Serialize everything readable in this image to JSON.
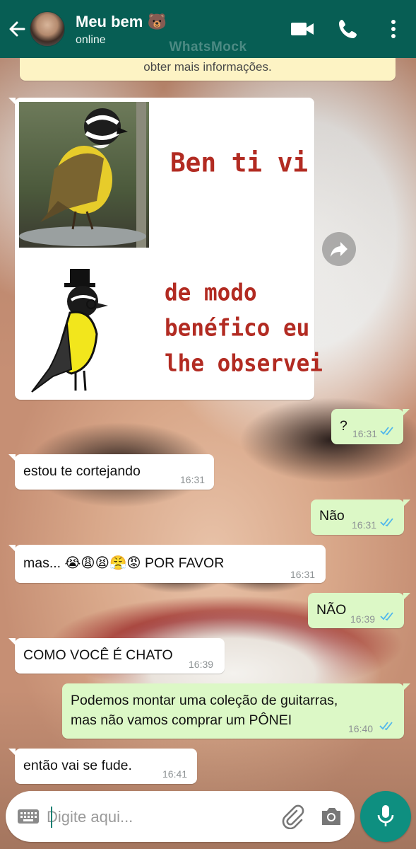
{
  "header": {
    "contact_name": "Meu bem 🐻",
    "status": "online",
    "watermark": "WhatsMock",
    "icons": [
      "back-arrow-icon",
      "video-call-icon",
      "phone-icon",
      "more-vert-icon"
    ]
  },
  "info_banner": "obter mais informações.",
  "messages": [
    {
      "dir": "in",
      "type": "image",
      "meme": {
        "line1": "Ben ti vi",
        "line2": "de modo",
        "line3": "benéfico eu",
        "line4": "lhe observei"
      }
    },
    {
      "dir": "out",
      "text": "?",
      "time": "16:31",
      "read": true
    },
    {
      "dir": "in",
      "text": "estou te cortejando",
      "time": "16:31"
    },
    {
      "dir": "out",
      "text": "Não",
      "time": "16:31",
      "read": true
    },
    {
      "dir": "in",
      "text": "mas... 😭😩😫😤😡 POR FAVOR",
      "time": "16:31"
    },
    {
      "dir": "out",
      "text": "NÃO",
      "time": "16:39",
      "read": true
    },
    {
      "dir": "in",
      "text": "COMO VOCÊ É CHATO",
      "time": "16:39"
    },
    {
      "dir": "out",
      "text_line1": "Podemos montar uma coleção de guitarras,",
      "text_line2": "mas não vamos comprar um PÔNEI",
      "time": "16:40",
      "read": true
    },
    {
      "dir": "in",
      "text": "então vai se fude.",
      "time": "16:41"
    }
  ],
  "input": {
    "placeholder": "Digite aqui..."
  },
  "colors": {
    "header": "#075e54",
    "outgoing": "#dcf8c6",
    "incoming": "#ffffff",
    "read_ticks": "#4fb6ec",
    "mic": "#0e8f80"
  }
}
